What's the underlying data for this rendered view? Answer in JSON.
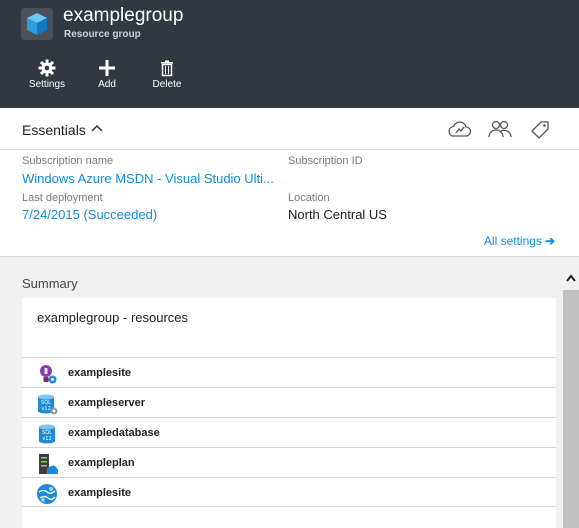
{
  "header": {
    "title": "examplegroup",
    "subtitle": "Resource group",
    "commands": [
      {
        "label": "Settings",
        "icon": "gear-icon"
      },
      {
        "label": "Add",
        "icon": "plus-icon"
      },
      {
        "label": "Delete",
        "icon": "trash-icon"
      }
    ]
  },
  "essentials": {
    "title": "Essentials",
    "fields": {
      "subscription_name_label": "Subscription name",
      "subscription_name_value": "Windows Azure MSDN - Visual Studio Ulti...",
      "subscription_id_label": "Subscription ID",
      "subscription_id_value": "",
      "last_deployment_label": "Last deployment",
      "last_deployment_value": "7/24/2015 (Succeeded)",
      "location_label": "Location",
      "location_value": "North Central US"
    },
    "all_settings": "All settings",
    "toolbar_icons": [
      "cloud-deploy-icon",
      "users-icon",
      "tag-icon"
    ]
  },
  "summary": {
    "label": "Summary",
    "panel_title": "examplegroup - resources",
    "resources": [
      {
        "name": "examplesite",
        "icon": "app-insights-icon"
      },
      {
        "name": "exampleserver",
        "icon": "sql-server-icon"
      },
      {
        "name": "exampledatabase",
        "icon": "sql-database-icon"
      },
      {
        "name": "exampleplan",
        "icon": "app-service-plan-icon"
      },
      {
        "name": "examplesite",
        "icon": "web-app-icon"
      }
    ]
  },
  "colors": {
    "header_bg": "#32383f",
    "link": "#0e8ed6",
    "accent_blue": "#1d8ad6"
  }
}
